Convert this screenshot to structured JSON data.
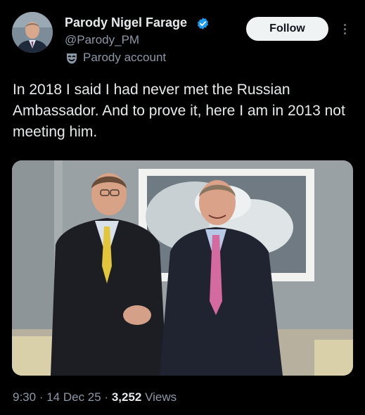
{
  "author": {
    "display_name": "Parody Nigel Farage",
    "handle": "@Parody_PM",
    "parody_label": "Parody account",
    "verified_color": "#1d9bf0",
    "verified_icon": "verified-badge-icon",
    "parody_icon": "theatre-mask-icon"
  },
  "actions": {
    "follow_label": "Follow",
    "more_icon": "more-vertical-icon"
  },
  "tweet": {
    "text": "In 2018 I said I had never met the Russian Ambassador. And to prove it, here I am in 2013 not meeting him."
  },
  "meta": {
    "time": "9:30",
    "sep1": " · ",
    "date": "14 Dec 25",
    "sep2": " · ",
    "views_count": "3,252",
    "views_label": " Views"
  },
  "colors": {
    "background": "#000000",
    "text_primary": "#e7e9ea",
    "text_secondary": "#8b98a5",
    "follow_bg": "#eff3f4"
  }
}
